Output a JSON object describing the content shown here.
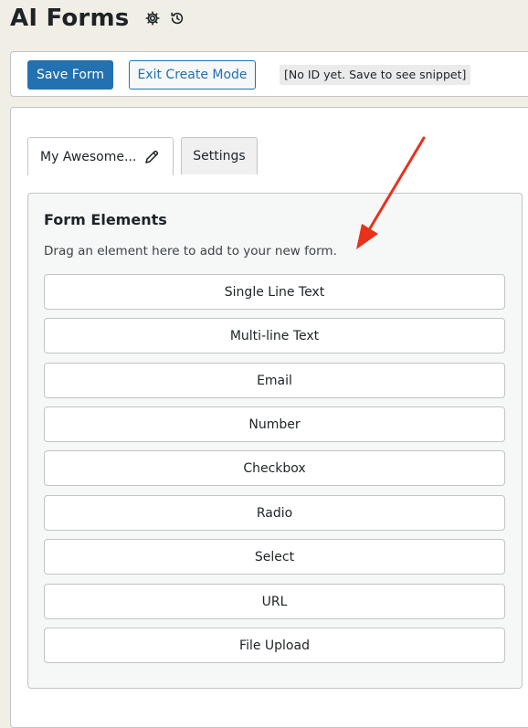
{
  "header": {
    "title": "AI Forms",
    "icons": [
      "gear-icon",
      "history-icon"
    ]
  },
  "toolbar": {
    "save_label": "Save Form",
    "exit_label": "Exit Create Mode",
    "snippet_note": "[No ID yet. Save to see snippet]"
  },
  "tabs": [
    {
      "label": "My Awesome...",
      "icon": "pencil-icon",
      "active": true
    },
    {
      "label": "Settings",
      "active": false
    }
  ],
  "form_elements": {
    "title": "Form Elements",
    "help": "Drag an element here to add to your new form.",
    "items": [
      {
        "label": "Single Line Text"
      },
      {
        "label": "Multi-line Text"
      },
      {
        "label": "Email"
      },
      {
        "label": "Number"
      },
      {
        "label": "Checkbox"
      },
      {
        "label": "Radio"
      },
      {
        "label": "Select"
      },
      {
        "label": "URL"
      },
      {
        "label": "File Upload"
      }
    ]
  },
  "colors": {
    "page_background": "#f1eee6",
    "primary": "#2271b1",
    "annotation_arrow": "#e8311a"
  }
}
